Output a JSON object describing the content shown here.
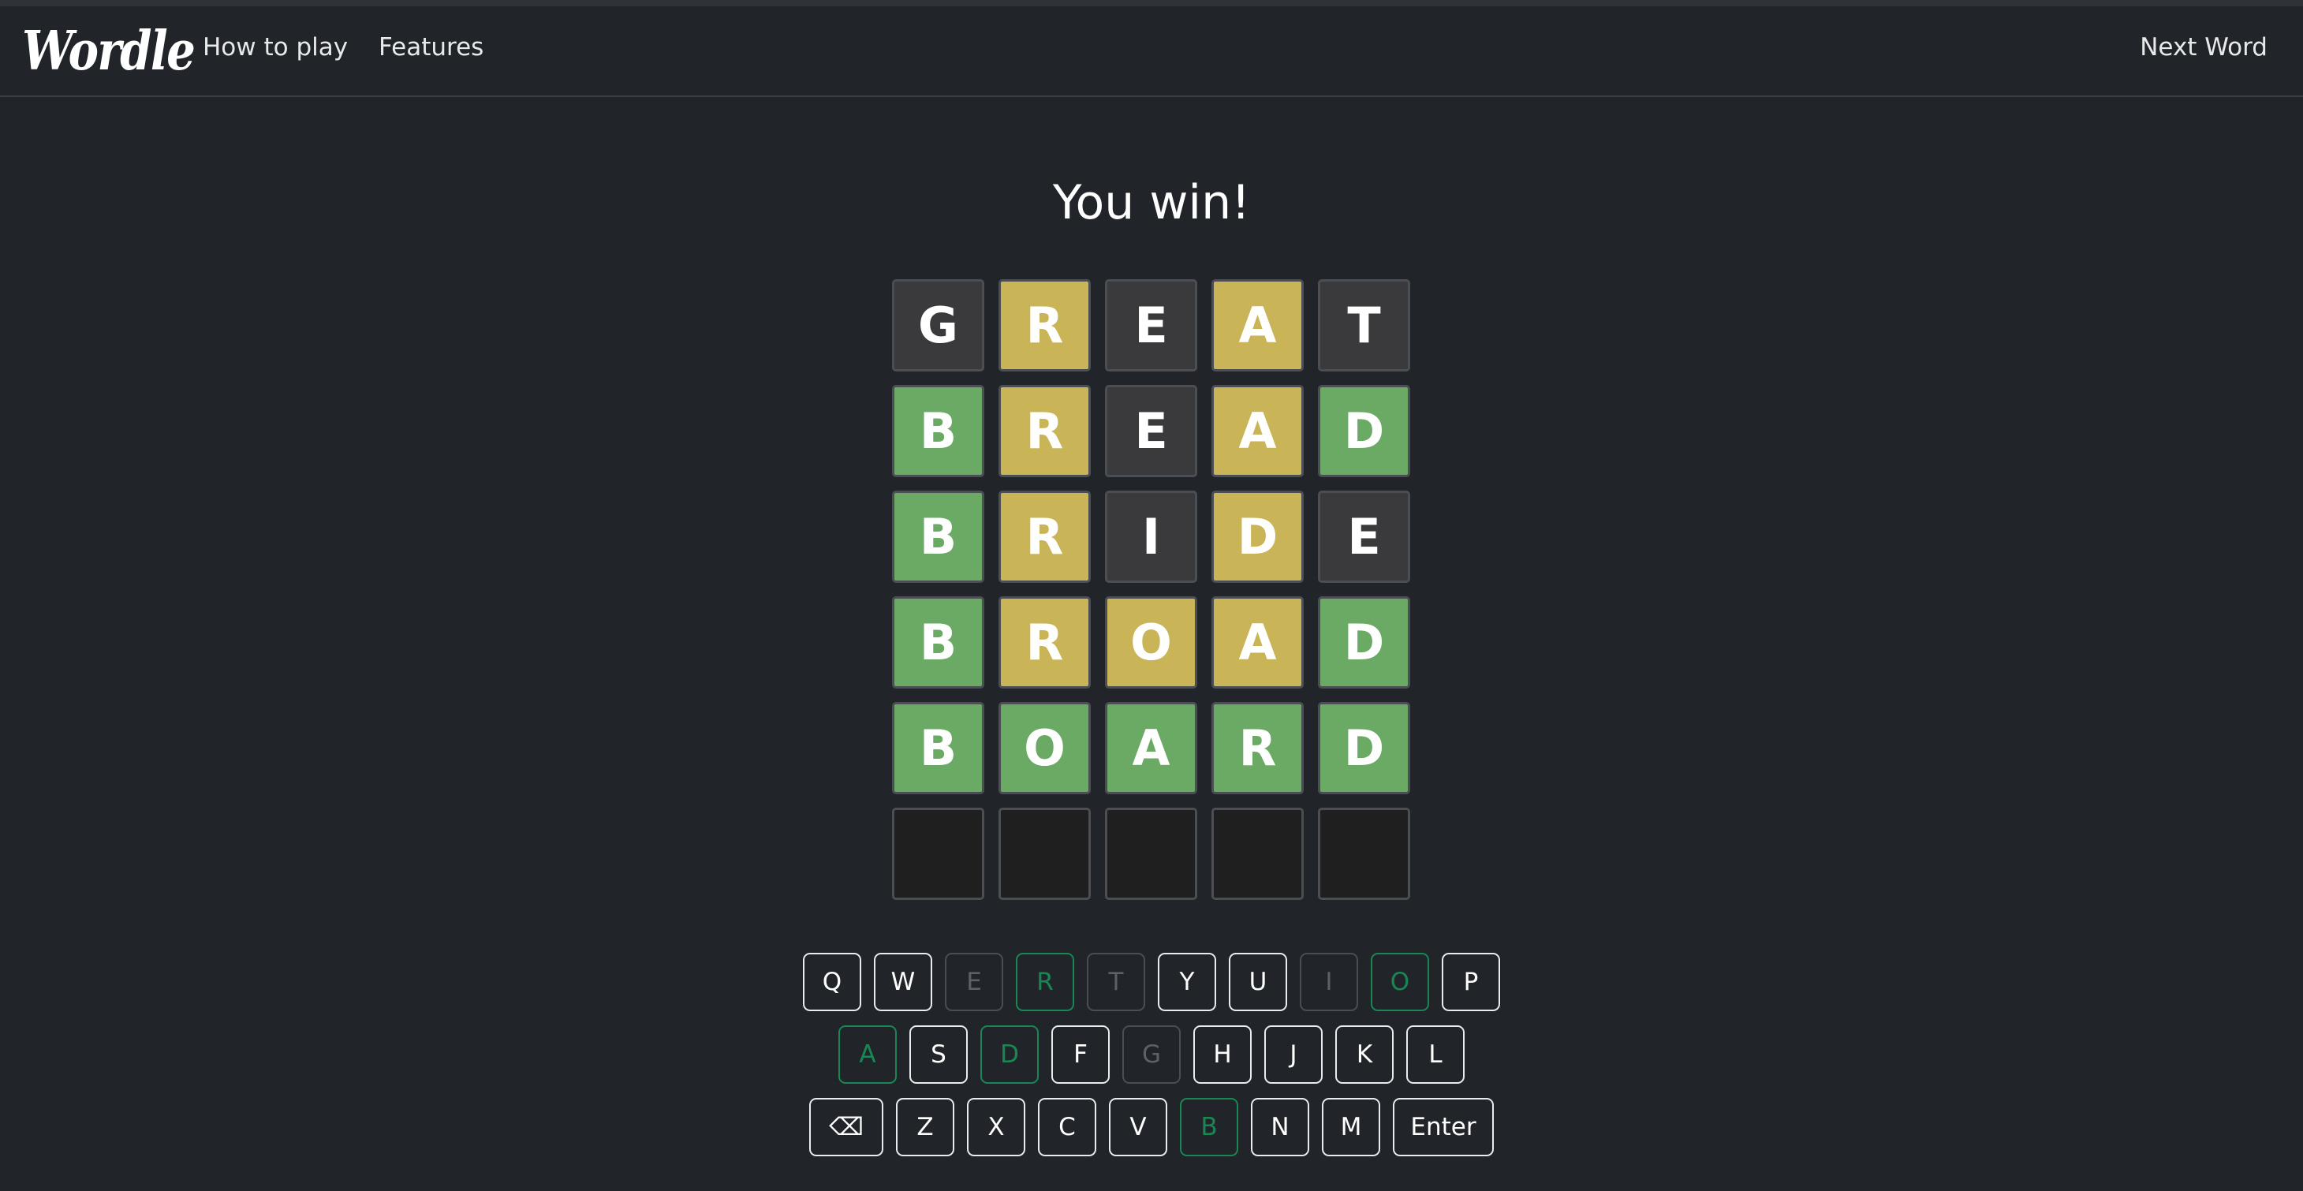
{
  "navbar": {
    "brand": "Wordle",
    "links": [
      "How to play",
      "Features"
    ],
    "next_word": "Next Word"
  },
  "status": {
    "message": "You win!"
  },
  "board": {
    "rows": [
      [
        {
          "letter": "G",
          "state": "absent"
        },
        {
          "letter": "R",
          "state": "present"
        },
        {
          "letter": "E",
          "state": "absent"
        },
        {
          "letter": "A",
          "state": "present"
        },
        {
          "letter": "T",
          "state": "absent"
        }
      ],
      [
        {
          "letter": "B",
          "state": "correct"
        },
        {
          "letter": "R",
          "state": "present"
        },
        {
          "letter": "E",
          "state": "absent"
        },
        {
          "letter": "A",
          "state": "present"
        },
        {
          "letter": "D",
          "state": "correct"
        }
      ],
      [
        {
          "letter": "B",
          "state": "correct"
        },
        {
          "letter": "R",
          "state": "present"
        },
        {
          "letter": "I",
          "state": "absent"
        },
        {
          "letter": "D",
          "state": "present"
        },
        {
          "letter": "E",
          "state": "absent"
        }
      ],
      [
        {
          "letter": "B",
          "state": "correct"
        },
        {
          "letter": "R",
          "state": "present"
        },
        {
          "letter": "O",
          "state": "present"
        },
        {
          "letter": "A",
          "state": "present"
        },
        {
          "letter": "D",
          "state": "correct"
        }
      ],
      [
        {
          "letter": "B",
          "state": "correct"
        },
        {
          "letter": "O",
          "state": "correct"
        },
        {
          "letter": "A",
          "state": "correct"
        },
        {
          "letter": "R",
          "state": "correct"
        },
        {
          "letter": "D",
          "state": "correct"
        }
      ],
      [
        {
          "letter": "",
          "state": "empty"
        },
        {
          "letter": "",
          "state": "empty"
        },
        {
          "letter": "",
          "state": "empty"
        },
        {
          "letter": "",
          "state": "empty"
        },
        {
          "letter": "",
          "state": "empty"
        }
      ]
    ]
  },
  "keyboard": {
    "rows": [
      [
        {
          "key": "Q",
          "state": "normal"
        },
        {
          "key": "W",
          "state": "normal"
        },
        {
          "key": "E",
          "state": "dim"
        },
        {
          "key": "R",
          "state": "hit"
        },
        {
          "key": "T",
          "state": "dim"
        },
        {
          "key": "Y",
          "state": "normal"
        },
        {
          "key": "U",
          "state": "normal"
        },
        {
          "key": "I",
          "state": "dim"
        },
        {
          "key": "O",
          "state": "hit"
        },
        {
          "key": "P",
          "state": "normal"
        }
      ],
      [
        {
          "key": "A",
          "state": "hit"
        },
        {
          "key": "S",
          "state": "normal"
        },
        {
          "key": "D",
          "state": "hit"
        },
        {
          "key": "F",
          "state": "normal"
        },
        {
          "key": "G",
          "state": "dim"
        },
        {
          "key": "H",
          "state": "normal"
        },
        {
          "key": "J",
          "state": "normal"
        },
        {
          "key": "K",
          "state": "normal"
        },
        {
          "key": "L",
          "state": "normal"
        }
      ],
      [
        {
          "key": "⌫",
          "state": "normal",
          "kind": "backspace"
        },
        {
          "key": "Z",
          "state": "normal"
        },
        {
          "key": "X",
          "state": "normal"
        },
        {
          "key": "C",
          "state": "normal"
        },
        {
          "key": "V",
          "state": "normal"
        },
        {
          "key": "B",
          "state": "hit"
        },
        {
          "key": "N",
          "state": "normal"
        },
        {
          "key": "M",
          "state": "normal"
        },
        {
          "key": "Enter",
          "state": "normal",
          "kind": "enter"
        }
      ]
    ]
  },
  "colors": {
    "background": "#212529",
    "tile_absent": "#3a3a3c",
    "tile_present": "#c9b458",
    "tile_correct": "#6aaa64",
    "tile_empty": "#1f1f1f",
    "key_hit": "#198754",
    "key_dim": "#5d6166"
  }
}
